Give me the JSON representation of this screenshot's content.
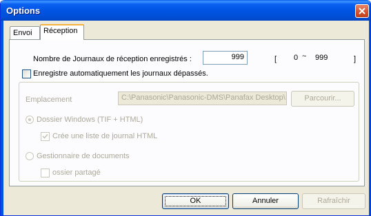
{
  "window": {
    "title": "Options"
  },
  "tabs": [
    {
      "label": "Envoi"
    },
    {
      "label": "Réception"
    }
  ],
  "journals": {
    "label": "Nombre de Journaux de réception enregistrés :",
    "value": "999",
    "range_open": "[",
    "range_min": "0",
    "range_sep": "~",
    "range_max": "999",
    "range_close": "]"
  },
  "auto_save": {
    "label": "Enregistre automatiquement les journaux dépassés.",
    "checked": false
  },
  "location": {
    "label": "Emplacement",
    "path": "C:\\Panasonic\\Panasonic-DMS\\Panafax Desktop\\Ini",
    "browse_label": "Parcourir..."
  },
  "windows_folder": {
    "label": "Dossier Windows (TIF + HTML)",
    "selected": true
  },
  "html_list": {
    "label": "Crée une liste de journal HTML",
    "checked": true
  },
  "doc_manager": {
    "label": "Gestionnaire de documents",
    "selected": false
  },
  "shared_folder": {
    "label": "ossier partagé",
    "checked": false
  },
  "buttons": {
    "ok": "OK",
    "cancel": "Annuler",
    "refresh": "Rafraîchir"
  }
}
